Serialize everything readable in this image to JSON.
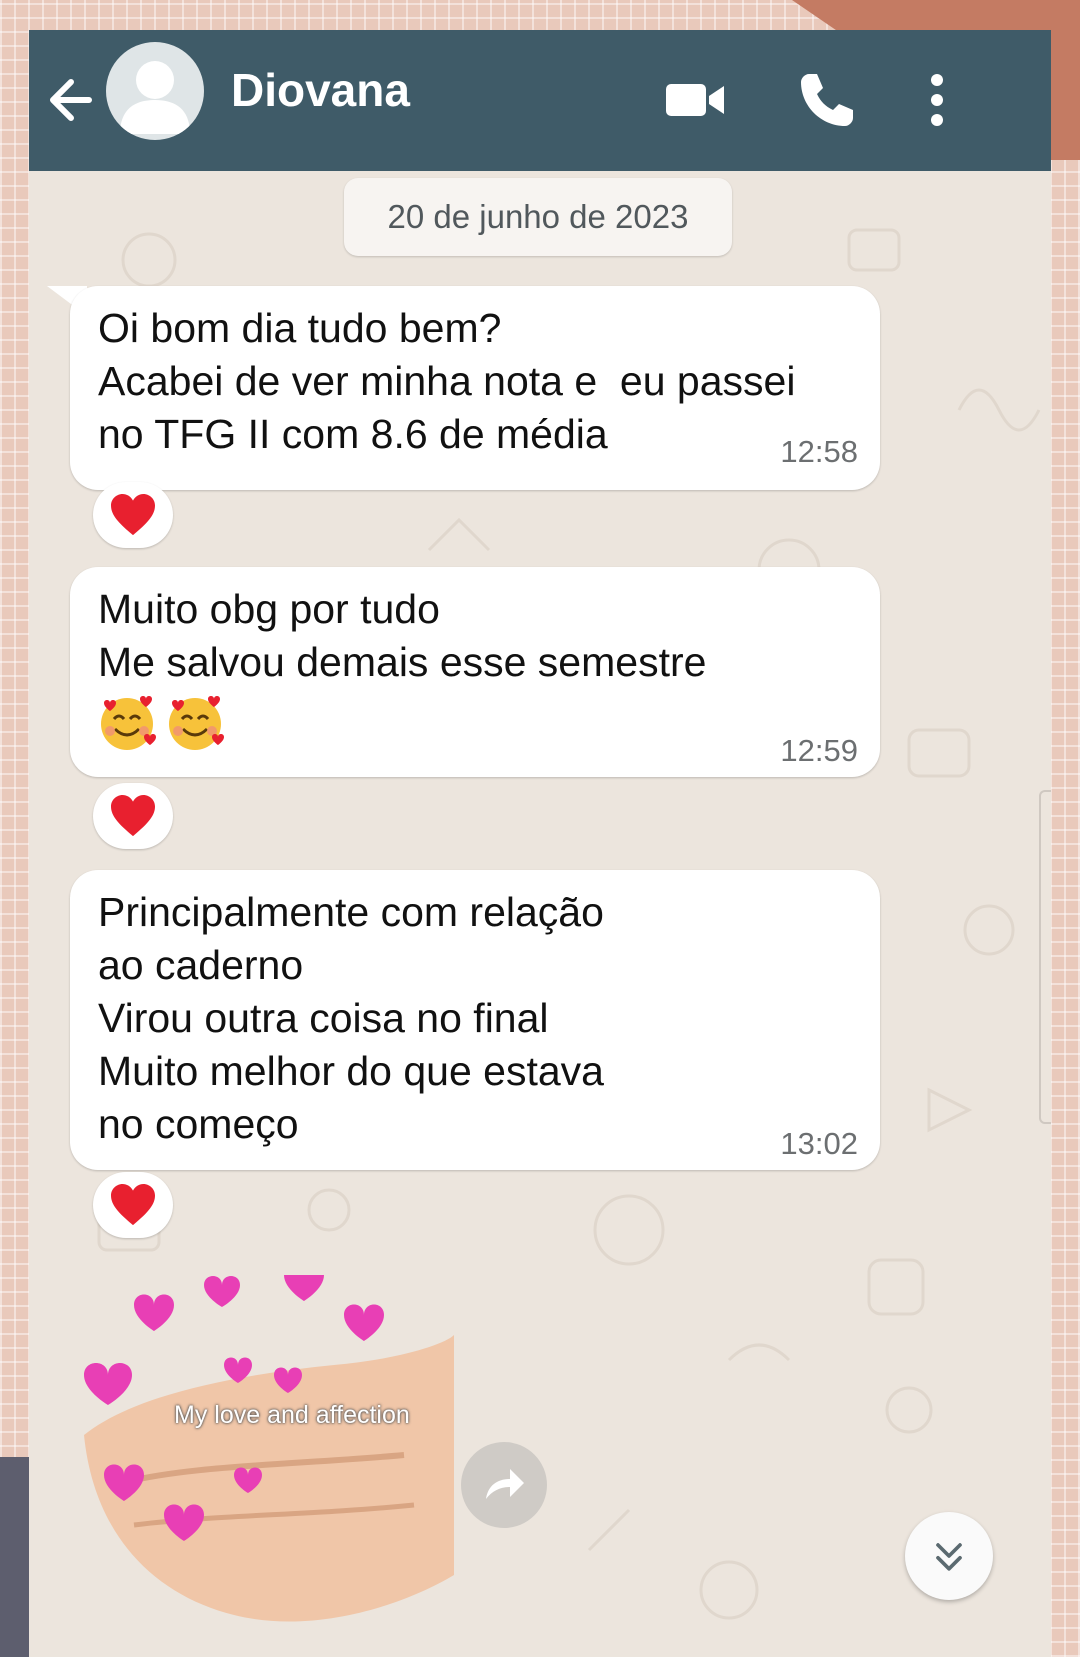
{
  "header": {
    "contact_name": "Diovana"
  },
  "date_label": "20 de junho de 2023",
  "messages": [
    {
      "text": "Oi bom dia tudo bem?\nAcabei de ver minha nota e  eu passei\nno TFG II com 8.6 de média",
      "time": "12:58",
      "reaction": "heart"
    },
    {
      "text": "Muito obg por tudo\nMe salvou demais esse semestre",
      "emoji": "smiling-face-with-hearts x2",
      "time": "12:59",
      "reaction": "heart"
    },
    {
      "text": "Principalmente com relação\nao caderno\nVirou outra coisa no final\nMuito melhor do que estava\nno começo",
      "time": "13:02",
      "reaction": "heart"
    }
  ],
  "sticker": {
    "caption": "My love and affection"
  },
  "colors": {
    "header": "#3f5b68",
    "chat_background": "#ece5dd",
    "bubble": "#ffffff",
    "heart": "#e8202f",
    "sticker_hearts": "#e83fb5"
  }
}
